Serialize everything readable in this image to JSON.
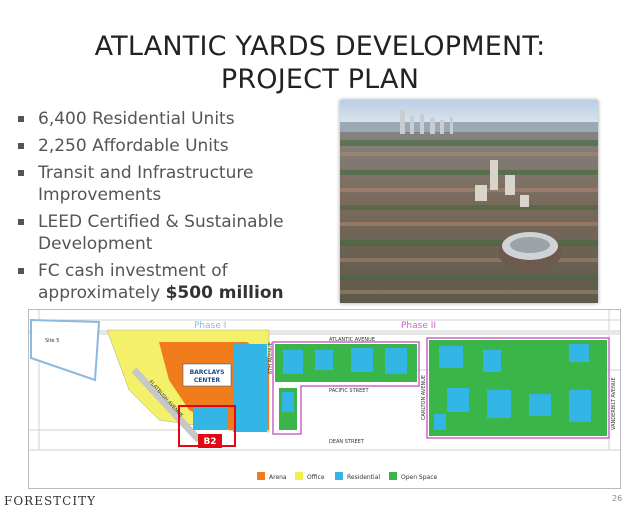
{
  "slide": {
    "title_line1": "ATLANTIC YARDS DEVELOPMENT:",
    "title_line2": "PROJECT PLAN",
    "bullets": [
      {
        "text": "6,400 Residential Units",
        "bold": ""
      },
      {
        "text": "2,250 Affordable Units",
        "bold": ""
      },
      {
        "text": "Transit and Infrastructure Improvements",
        "bold": ""
      },
      {
        "text": "LEED Certified & Sustainable Development",
        "bold": ""
      },
      {
        "text": "FC cash investment of approximately ",
        "bold": "$500 million"
      }
    ],
    "logo": "FORESTCITY",
    "page_number": "26"
  },
  "map": {
    "phase1": "Phase I",
    "phase2": "Phase II",
    "streets": {
      "atlantic": "ATLANTIC AVENUE",
      "pacific": "PACIFIC STREET",
      "dean": "DEAN STREET",
      "flatbush": "FLATBUSH AVENUE",
      "sixth": "6TH AVENUE",
      "carlton": "CARLTON AVENUE",
      "vanderbilt": "VANDERBILT AVENUE"
    },
    "arena_line1": "BARCLAYS",
    "arena_line2": "CENTER",
    "site5": "Site 5",
    "b2": "B2",
    "legend": [
      {
        "label": "Arena",
        "color": "#f07c1c"
      },
      {
        "label": "Office",
        "color": "#f3f04a"
      },
      {
        "label": "Residential",
        "color": "#33b5e5"
      },
      {
        "label": "Open Space",
        "color": "#39b54a"
      }
    ]
  }
}
